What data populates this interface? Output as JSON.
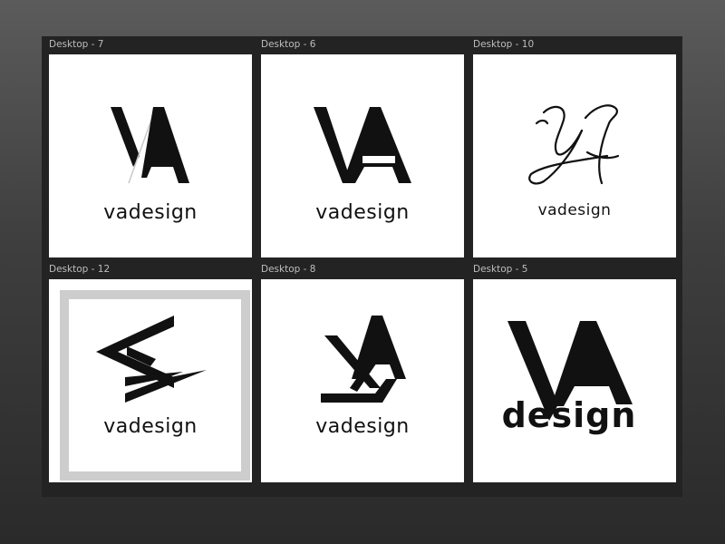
{
  "colors": {
    "canvas": "#232323",
    "artboard": "#ffffff",
    "ink": "#111111",
    "frame": "#cdcdcd",
    "label": "#bdbdbd"
  },
  "artboards": [
    {
      "label": "Desktop - 7",
      "wordmark": "vadesign"
    },
    {
      "label": "Desktop - 6",
      "wordmark": "vadesign"
    },
    {
      "label": "Desktop - 10",
      "wordmark": "vadesign"
    },
    {
      "label": "Desktop - 12",
      "wordmark": "vadesign"
    },
    {
      "label": "Desktop - 8",
      "wordmark": "vadesign"
    },
    {
      "label": "Desktop - 5",
      "wordmark": "design"
    }
  ]
}
